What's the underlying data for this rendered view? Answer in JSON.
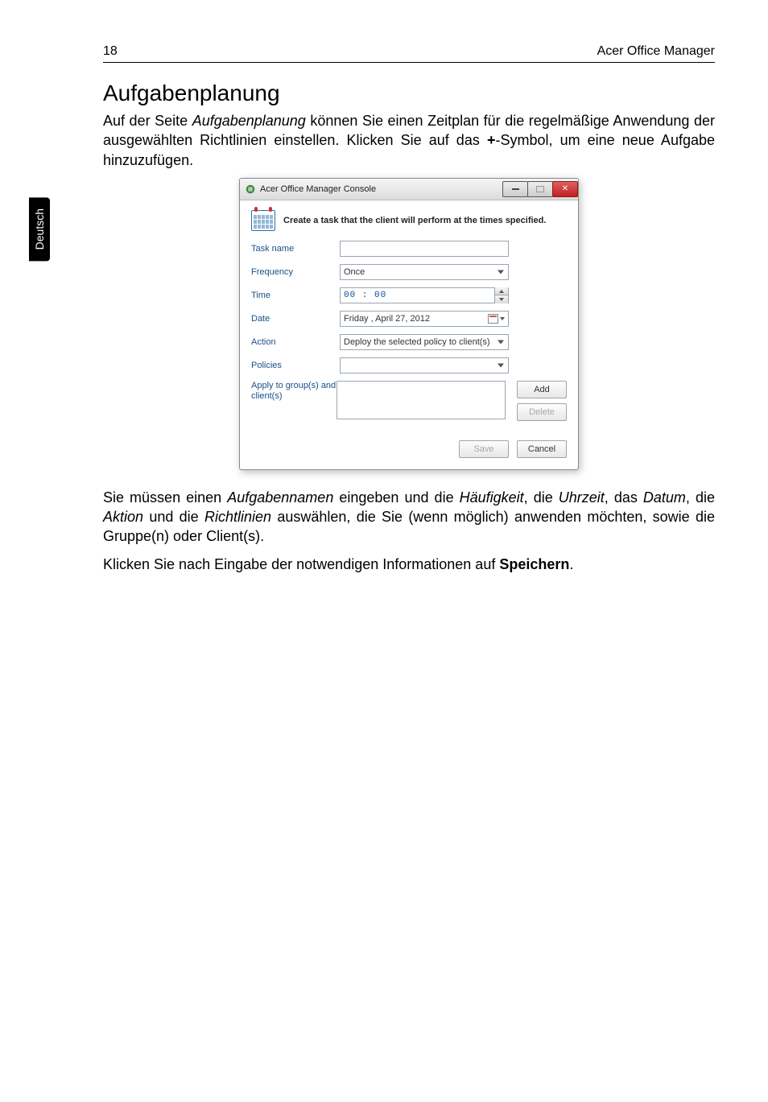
{
  "header": {
    "page_number": "18",
    "product": "Acer Office Manager"
  },
  "side_tab": "Deutsch",
  "section": {
    "title": "Aufgabenplanung",
    "intro_html": "Auf der Seite <span class=\"italic\">Aufgabenplanung</span> können Sie einen Zeitplan für die regelmäßige Anwendung der ausgewählten Richtlinien einstellen. Klicken Sie auf das <span class=\"bold\">+</span>-Symbol, um eine neue Aufgabe hinzuzufügen.",
    "paragraph2_html": "Sie müssen einen <span class=\"italic\">Aufgabennamen</span> eingeben und die <span class=\"italic\">Häufigkeit</span>, die <span class=\"italic\">Uhrzeit</span>, das <span class=\"italic\">Datum</span>, die <span class=\"italic\">Aktion</span> und die <span class=\"italic\">Richtlinien</span> auswählen, die Sie (wenn möglich) anwenden möchten, sowie die Gruppe(n) oder Client(s).",
    "paragraph3_html": "Klicken Sie nach Eingabe der notwendigen Informationen auf <span class=\"bold\">Speichern</span>."
  },
  "dialog": {
    "title": "Acer Office Manager Console",
    "header_text": "Create a task that the client will perform at the times specified.",
    "labels": {
      "task_name": "Task name",
      "frequency": "Frequency",
      "time": "Time",
      "date": "Date",
      "action": "Action",
      "policies": "Policies",
      "apply_to": "Apply to group(s) and client(s)"
    },
    "values": {
      "task_name": "",
      "frequency": "Once",
      "time": "00 : 00",
      "date": "Friday   ,   April    27, 2012",
      "action": "Deploy the selected policy to client(s)",
      "policies": ""
    },
    "buttons": {
      "add": "Add",
      "delete": "Delete",
      "save": "Save",
      "cancel": "Cancel"
    }
  }
}
